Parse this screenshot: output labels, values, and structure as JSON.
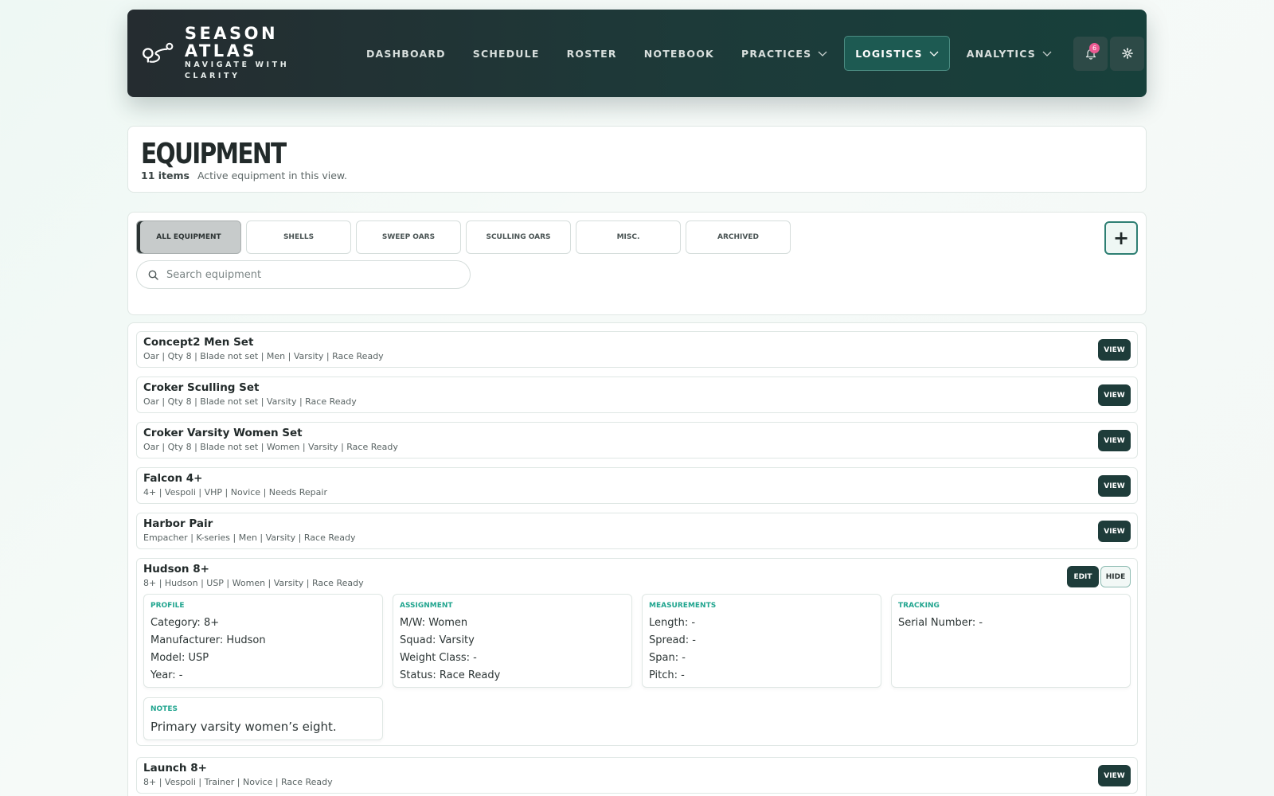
{
  "brand": {
    "title": "SEASON ATLAS",
    "subtitle": "NAVIGATE WITH CLARITY"
  },
  "nav": {
    "items": [
      {
        "label": "DASHBOARD",
        "dropdown": false,
        "active": false
      },
      {
        "label": "SCHEDULE",
        "dropdown": false,
        "active": false
      },
      {
        "label": "ROSTER",
        "dropdown": false,
        "active": false
      },
      {
        "label": "NOTEBOOK",
        "dropdown": false,
        "active": false
      },
      {
        "label": "PRACTICES",
        "dropdown": true,
        "active": false
      },
      {
        "label": "LOGISTICS",
        "dropdown": true,
        "active": true
      },
      {
        "label": "ANALYTICS",
        "dropdown": true,
        "active": false
      }
    ],
    "notifications_count": "6",
    "icons": [
      "bell-icon",
      "gear-icon"
    ]
  },
  "header": {
    "title": "EQUIPMENT",
    "count": "11 items",
    "description": "Active equipment in this view."
  },
  "filters": {
    "tabs": [
      "ALL EQUIPMENT",
      "SHELLS",
      "SWEEP OARS",
      "SCULLING OARS",
      "MISC.",
      "ARCHIVED"
    ],
    "active_tab": "ALL EQUIPMENT",
    "add_label": "+",
    "search_placeholder": "Search equipment"
  },
  "list": {
    "view_label": "VIEW",
    "edit_label": "EDIT",
    "hide_label": "HIDE",
    "items": [
      {
        "name": "Concept2 Men Set",
        "meta": "Oar | Qty 8 | Blade not set | Men | Varsity | Race Ready"
      },
      {
        "name": "Croker Sculling Set",
        "meta": "Oar | Qty 8 | Blade not set | Varsity | Race Ready"
      },
      {
        "name": "Croker Varsity Women Set",
        "meta": "Oar | Qty 8 | Blade not set | Women | Varsity | Race Ready"
      },
      {
        "name": "Falcon 4+",
        "meta": "4+ | Vespoli | VHP | Novice | Needs Repair"
      },
      {
        "name": "Harbor Pair",
        "meta": "Empacher | K-series | Men | Varsity | Race Ready"
      },
      {
        "name": "Hudson 8+",
        "meta": "8+ | Hudson | USP | Women | Varsity | Race Ready"
      },
      {
        "name": "Launch 8+",
        "meta": "8+ | Vespoli | Trainer | Novice | Race Ready"
      }
    ],
    "expanded": {
      "sections": [
        {
          "title": "PROFILE",
          "lines": [
            "Category: 8+",
            "Manufacturer: Hudson",
            "Model: USP",
            "Year: -"
          ]
        },
        {
          "title": "ASSIGNMENT",
          "lines": [
            "M/W: Women",
            "Squad: Varsity",
            "Weight Class: -",
            "Status: Race Ready"
          ]
        },
        {
          "title": "MEASUREMENTS",
          "lines": [
            "Length: -",
            "Spread: -",
            "Span: -",
            "Pitch: -"
          ]
        },
        {
          "title": "TRACKING",
          "lines": [
            "Serial Number: -"
          ]
        }
      ],
      "notes": {
        "title": "NOTES",
        "text": "Primary varsity women’s eight."
      }
    }
  }
}
